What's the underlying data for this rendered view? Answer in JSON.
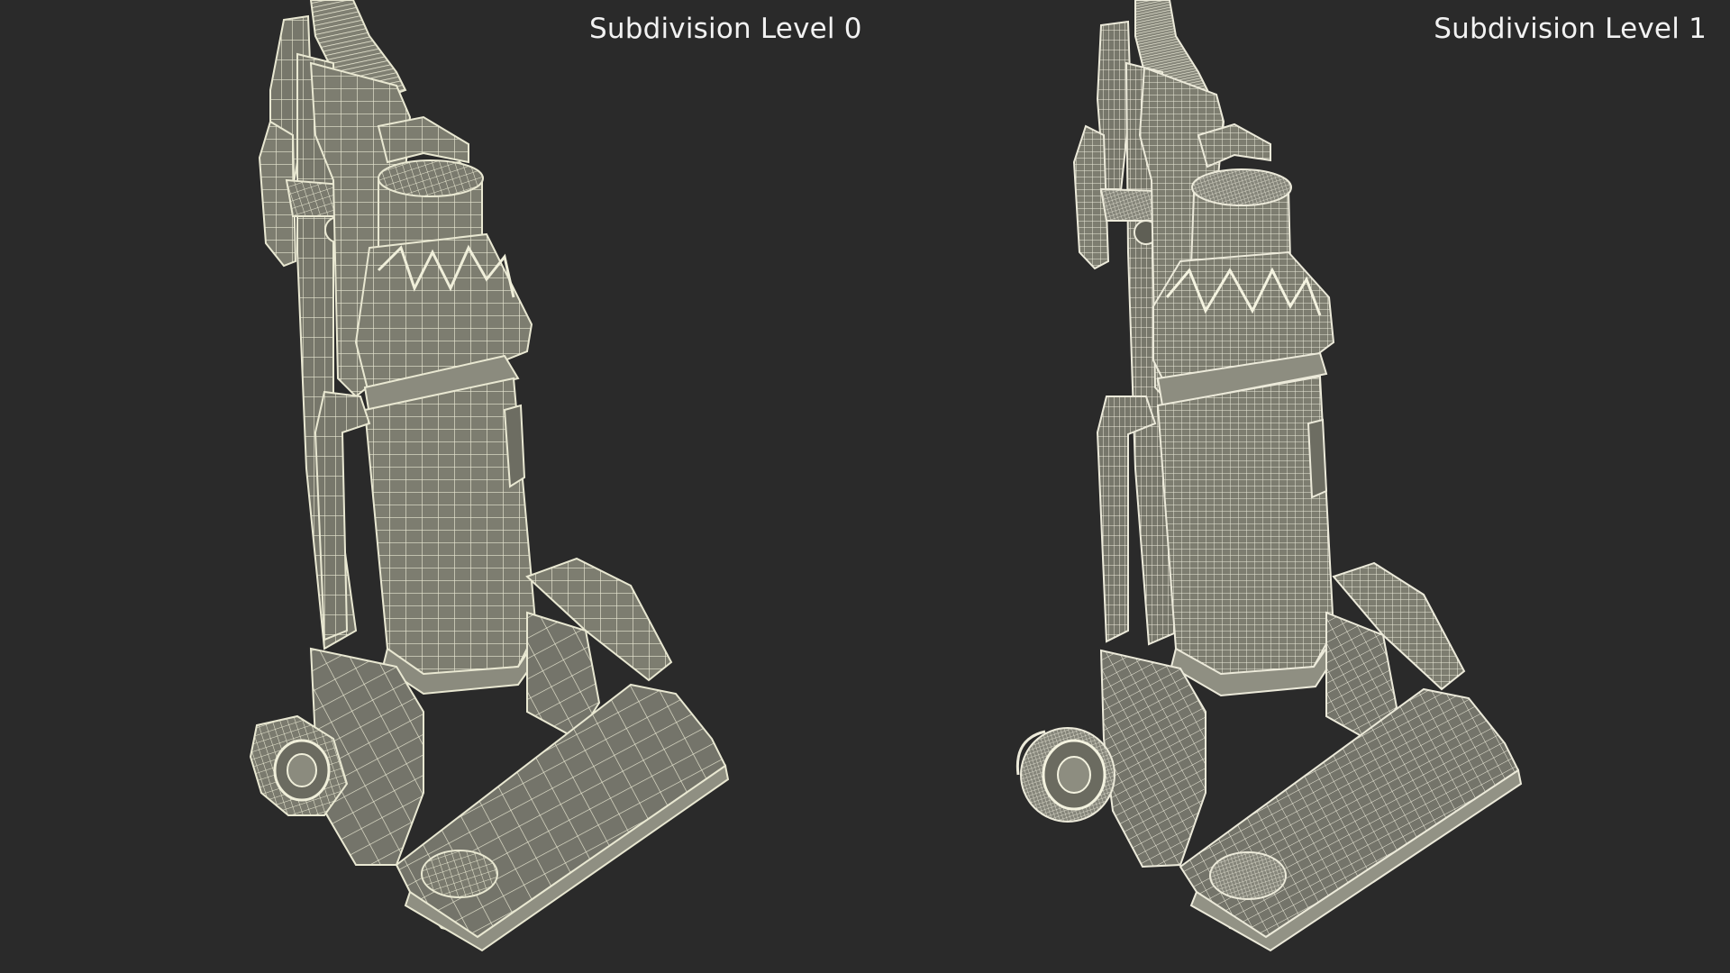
{
  "labels": {
    "left": "Subdivision Level 0",
    "right": "Subdivision Level 1"
  },
  "colors": {
    "background": "#2a2a2a",
    "body": "#7c7c6f",
    "body_dark": "#5f5f55",
    "body_light": "#93938a",
    "wire": "#ecebd6"
  }
}
